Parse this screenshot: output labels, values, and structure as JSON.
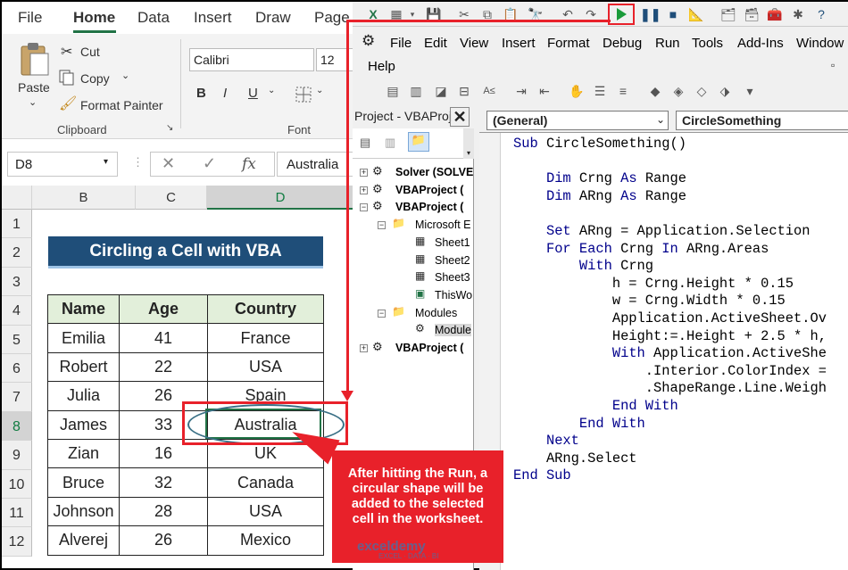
{
  "excel": {
    "menu": [
      "File",
      "Home",
      "Data",
      "Insert",
      "Draw",
      "Page"
    ],
    "active_menu": "Home",
    "clipboard": {
      "paste": "Paste",
      "cut": "Cut",
      "copy": "Copy",
      "format_painter": "Format Painter",
      "group_label": "Clipboard"
    },
    "font": {
      "name": "Calibri",
      "size": "12",
      "bold": "B",
      "italic": "I",
      "underline": "U",
      "group_label": "Font"
    },
    "name_box": "D8",
    "formula_value": "Australia",
    "fx_label": "fx",
    "columns": [
      "B",
      "C",
      "D"
    ],
    "rows": [
      "1",
      "2",
      "3",
      "4",
      "5",
      "6",
      "7",
      "8",
      "9",
      "10",
      "11",
      "12"
    ],
    "selected_row": "8",
    "selected_column": "D",
    "title": "Circling a Cell with VBA",
    "table": {
      "headers": [
        "Name",
        "Age",
        "Country"
      ],
      "rows": [
        [
          "Emilia",
          "41",
          "France"
        ],
        [
          "Robert",
          "22",
          "USA"
        ],
        [
          "Julia",
          "26",
          "Spain"
        ],
        [
          "James",
          "33",
          "Australia"
        ],
        [
          "Zian",
          "16",
          "UK"
        ],
        [
          "Bruce",
          "32",
          "Canada"
        ],
        [
          "Johnson",
          "28",
          "USA"
        ],
        [
          "Alverej",
          "26",
          "Mexico"
        ]
      ]
    }
  },
  "vba": {
    "menu": [
      "File",
      "Edit",
      "View",
      "Insert",
      "Format",
      "Debug",
      "Run",
      "Tools",
      "Add-Ins",
      "Window",
      "Help"
    ],
    "project_title": "Project - VBAProj",
    "tree": [
      "Solver (SOLVE",
      "VBAProject (",
      "VBAProject (",
      "Microsoft E",
      "Sheet1",
      "Sheet2",
      "Sheet3",
      "ThisWo",
      "Modules",
      "Module",
      "VBAProject ("
    ],
    "combo_left": "(General)",
    "combo_right": "CircleSomething"
  },
  "callout": "After hitting the Run, a circular shape will be added to the selected cell in the worksheet.",
  "watermark": {
    "brand": "exceldemy",
    "tagline": "EXCEL · DATA · BI"
  },
  "colors": {
    "accent_red": "#e8212a",
    "excel_green": "#217346",
    "title_blue": "#1f4e79",
    "header_green": "#e2efda",
    "vba_keyword": "#00008b"
  }
}
